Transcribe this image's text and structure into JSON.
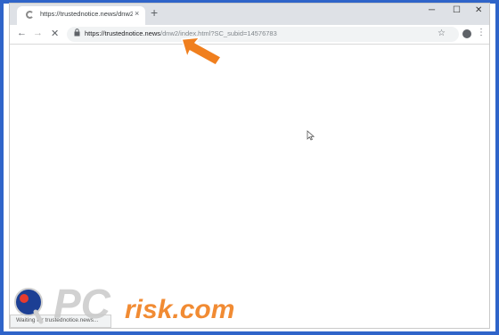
{
  "tab": {
    "title": "https://trustednotice.news/dnw2/",
    "close": "×",
    "new_tab": "+"
  },
  "window_controls": {
    "minimize": "─",
    "maximize": "☐",
    "close": "✕"
  },
  "nav": {
    "back": "←",
    "forward": "→",
    "stop": "✕"
  },
  "address_bar": {
    "host": "https://trustednotice.news",
    "path": "/dnw2/index.html?SC_subid=14576783"
  },
  "toolbar_icons": {
    "star": "☆",
    "menu": "⋮"
  },
  "status": "Waiting for trustednotice.news...",
  "watermark": {
    "text": "PC",
    "suffix": "risk.com"
  }
}
